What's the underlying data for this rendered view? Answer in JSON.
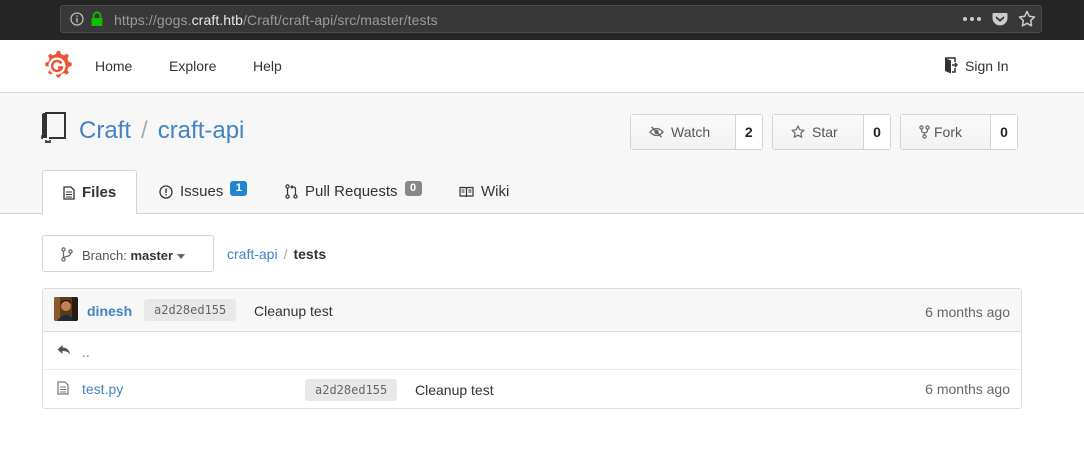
{
  "browser": {
    "url_prefix": "https://gogs.",
    "url_host": "craft.htb",
    "url_path": "/Craft/craft-api/src/master/tests",
    "icons": [
      "info-icon",
      "lock-icon",
      "more-icon",
      "pocket-icon",
      "bookmark-star-icon"
    ]
  },
  "navbar": {
    "home": "Home",
    "explore": "Explore",
    "help": "Help",
    "sign_in": "Sign In"
  },
  "repo": {
    "owner": "Craft",
    "separator": "/",
    "name": "craft-api",
    "watch_label": "Watch",
    "watch_count": "2",
    "star_label": "Star",
    "star_count": "0",
    "fork_label": "Fork",
    "fork_count": "0"
  },
  "tabs": [
    {
      "label": "Files",
      "active": true
    },
    {
      "label": "Issues",
      "badge": "1",
      "badge_color": "#2185d0"
    },
    {
      "label": "Pull Requests",
      "badge": "0",
      "badge_color": "#888888"
    },
    {
      "label": "Wiki"
    }
  ],
  "branch": {
    "prefix": "Branch:",
    "name": "master"
  },
  "breadcrumb": {
    "root": "craft-api",
    "separator": "/",
    "current": "tests"
  },
  "latest_commit": {
    "author": "dinesh",
    "sha": "a2d28ed155",
    "message": "Cleanup test",
    "age": "6 months ago"
  },
  "parent_dir": {
    "label": ".."
  },
  "files": [
    {
      "name": "test.py",
      "sha": "a2d28ed155",
      "message": "Cleanup test",
      "age": "6 months ago"
    }
  ],
  "colors": {
    "link": "#4183c4",
    "logo": "#f05133"
  }
}
